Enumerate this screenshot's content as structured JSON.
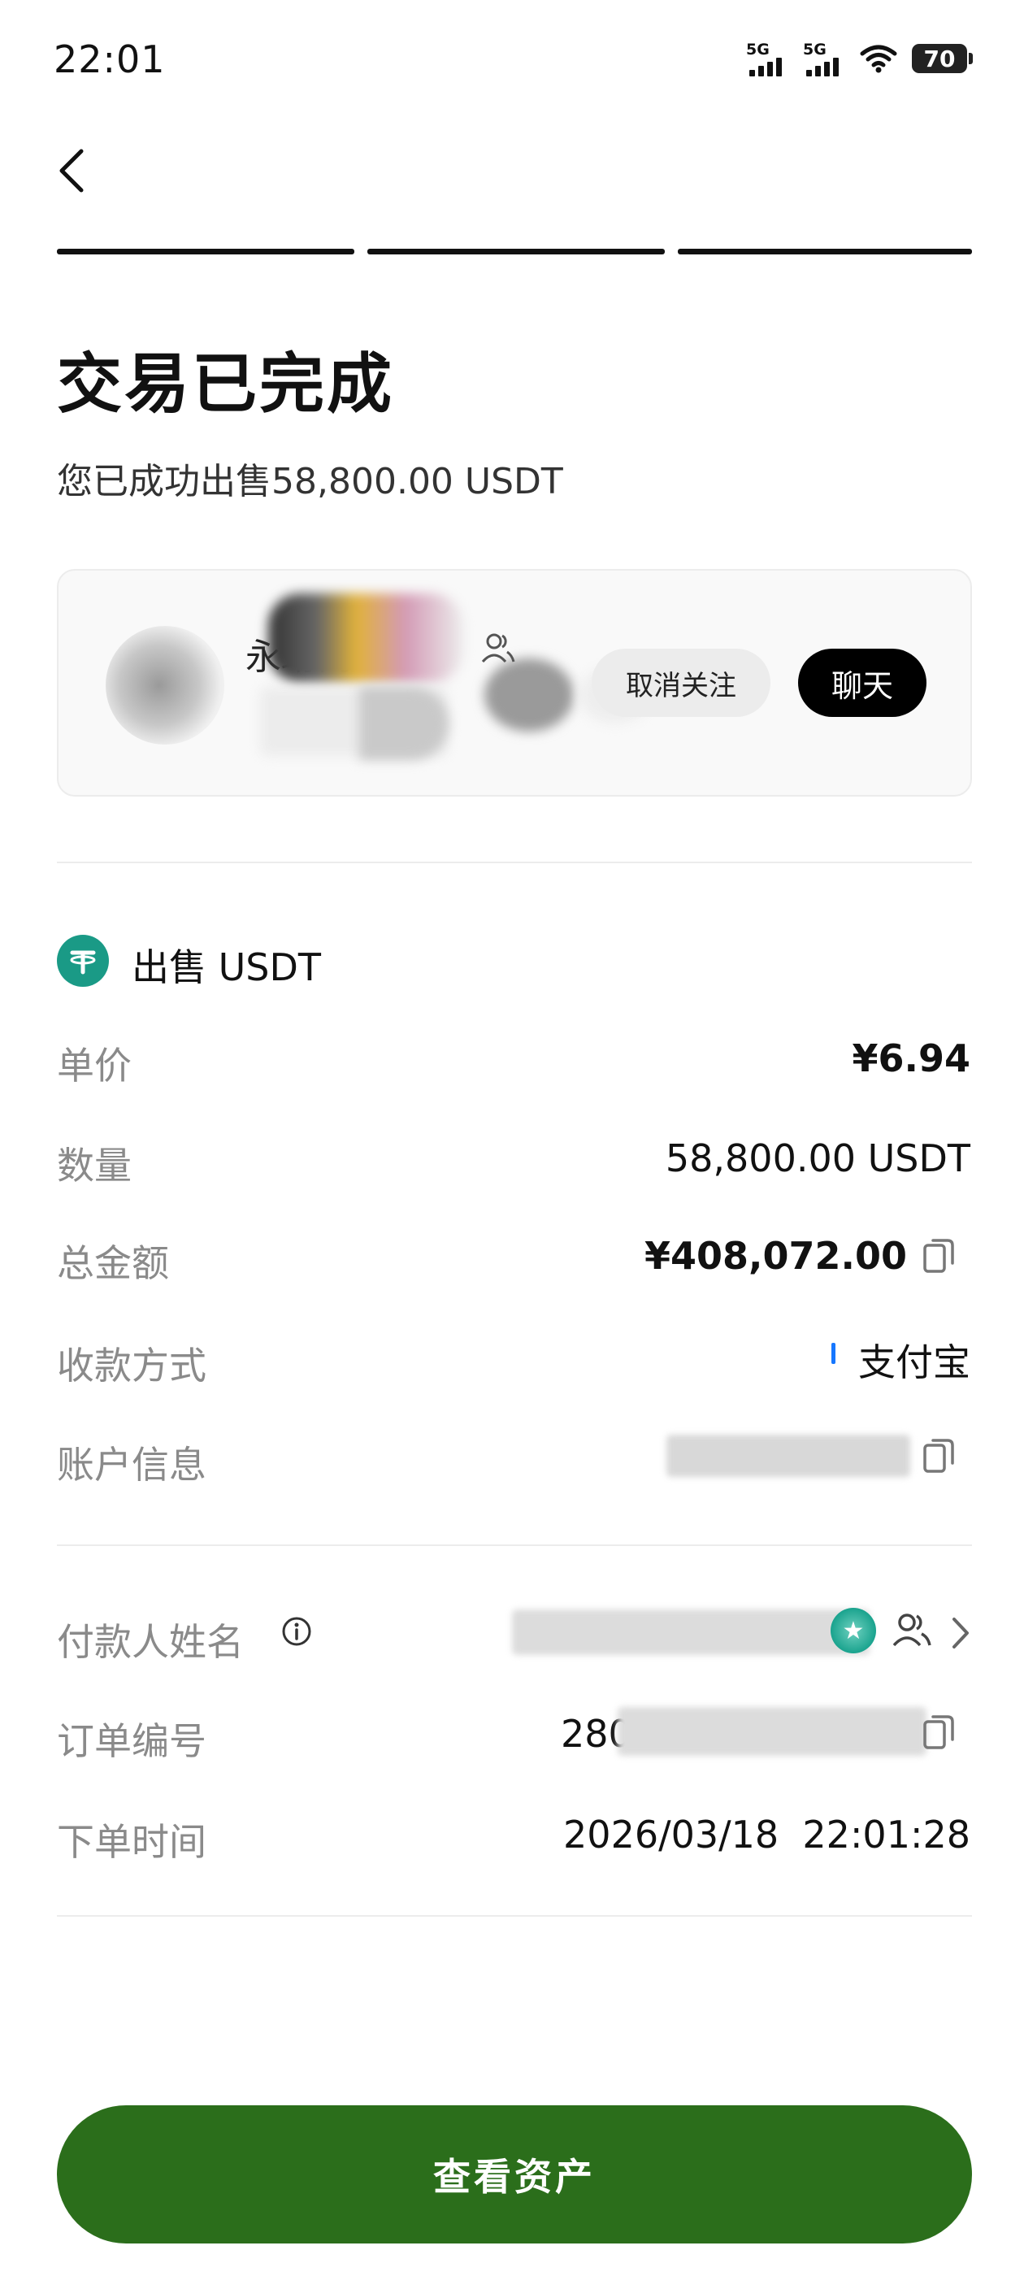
{
  "status_bar": {
    "time": "22:01",
    "net1": "5G",
    "net2": "5G",
    "battery": "70",
    "icons": [
      "signal-5g-icon",
      "signal-5g-icon",
      "wifi-icon",
      "battery-icon"
    ]
  },
  "nav": {
    "back_icon": "chevron-left-icon"
  },
  "progress": {
    "steps_total": 3,
    "steps_completed": 3
  },
  "header": {
    "title": "交易已完成",
    "subtitle": "您已成功出售58,800.00 USDT"
  },
  "merchant": {
    "name_visible": "永珩商",
    "unfollow_label": "取消关注",
    "chat_label": "聊天"
  },
  "order": {
    "section_title": "出售 USDT",
    "coin_icon": "tether-icon",
    "rows": {
      "price": {
        "label": "单价",
        "value": "¥6.94"
      },
      "quantity": {
        "label": "数量",
        "value": "58,800.00 USDT"
      },
      "total": {
        "label": "总金额",
        "value": "¥408,072.00"
      },
      "payment_method": {
        "label": "收款方式",
        "value": "支付宝"
      },
      "account_info": {
        "label": "账户信息"
      }
    },
    "details": {
      "payer_name": {
        "label": "付款人姓名"
      },
      "order_no": {
        "label": "订单编号",
        "value_prefix": "280"
      },
      "order_time": {
        "label": "下单时间",
        "value": "2026/03/18  22:01:28"
      }
    }
  },
  "cta": {
    "label": "查看资产"
  },
  "colors": {
    "primary_button": "#2b6e1b",
    "tether": "#1a9a86",
    "alipay": "#1677ff"
  }
}
